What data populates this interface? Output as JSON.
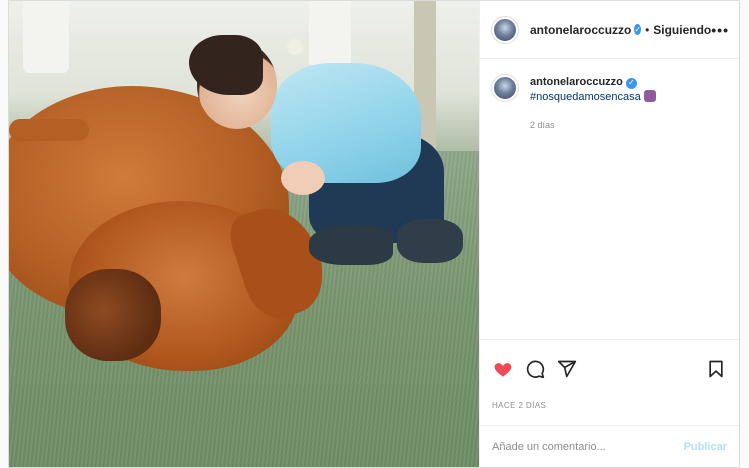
{
  "post": {
    "username": "antonelaroccuzzo",
    "follow_state": "Siguiendo",
    "dot_separator": "•",
    "more_icon": "ellipsis-icon",
    "caption": {
      "username": "antonelaroccuzzo",
      "hashtag": "#nosquedamosencasa",
      "time": "2 días"
    },
    "posted_ago": "HACE 2 DÍAS"
  },
  "actions": {
    "like_icon": "heart-icon",
    "comment_icon": "comment-icon",
    "share_icon": "share-icon",
    "save_icon": "bookmark-icon",
    "liked": true
  },
  "comment": {
    "placeholder": "Añade un comentario...",
    "publish_label": "Publicar"
  },
  "colors": {
    "like": "#ed4956",
    "verified": "#3897f0",
    "hashtag": "#00376b",
    "publish_disabled": "#b2dffc"
  }
}
